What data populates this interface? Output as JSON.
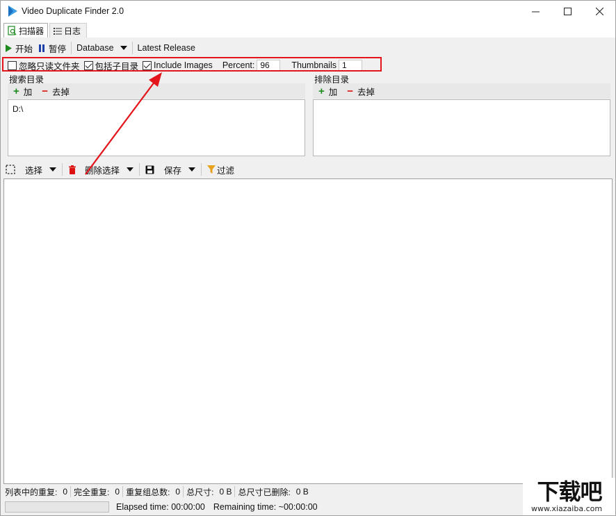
{
  "window": {
    "title": "Video Duplicate Finder 2.0"
  },
  "tabs": [
    {
      "label": "扫描器"
    },
    {
      "label": "日志"
    }
  ],
  "toolbar": {
    "start_label": "开始",
    "pause_label": "暂停",
    "database_label": "Database",
    "latest_release_label": "Latest Release"
  },
  "options": {
    "ignore_readonly_label": "忽略只读文件夹",
    "ignore_readonly_checked": false,
    "include_subdirs_label": "包括子目录",
    "include_subdirs_checked": true,
    "include_images_label": "Include Images",
    "include_images_checked": true,
    "percent_label": "Percent:",
    "percent_value": "96",
    "thumbnails_label": "Thumbnails",
    "thumbnails_value": "1"
  },
  "search_dirs": {
    "title": "搜索目录",
    "add_label": "加",
    "remove_label": "去掉",
    "items": [
      "D:\\"
    ]
  },
  "exclude_dirs": {
    "title": "排除目录",
    "add_label": "加",
    "remove_label": "去掉",
    "items": []
  },
  "results_toolbar": {
    "select_label": "选择",
    "delete_label": "删除选择",
    "save_label": "保存",
    "filter_label": "过滤"
  },
  "status": {
    "dupes_in_list_label": "列表中的重复:",
    "dupes_in_list_value": "0",
    "full_dupes_label": "完全重复:",
    "full_dupes_value": "0",
    "groups_label": "重复组总数:",
    "groups_value": "0",
    "total_size_label": "总尺寸:",
    "total_size_value": "0 B",
    "deleted_size_label": "总尺寸已删除:",
    "deleted_size_value": "0 B"
  },
  "timing": {
    "elapsed": "Elapsed time: 00:00:00",
    "remaining": "Remaining time: ~00:00:00",
    "progress": 0
  },
  "watermark": {
    "text": "下载吧",
    "url": "www.xiazaiba.com"
  },
  "colors": {
    "highlight": "#e3141b",
    "accent_green": "#1f8a1f",
    "accent_red": "#d11111",
    "pause_blue": "#1c3faa"
  }
}
